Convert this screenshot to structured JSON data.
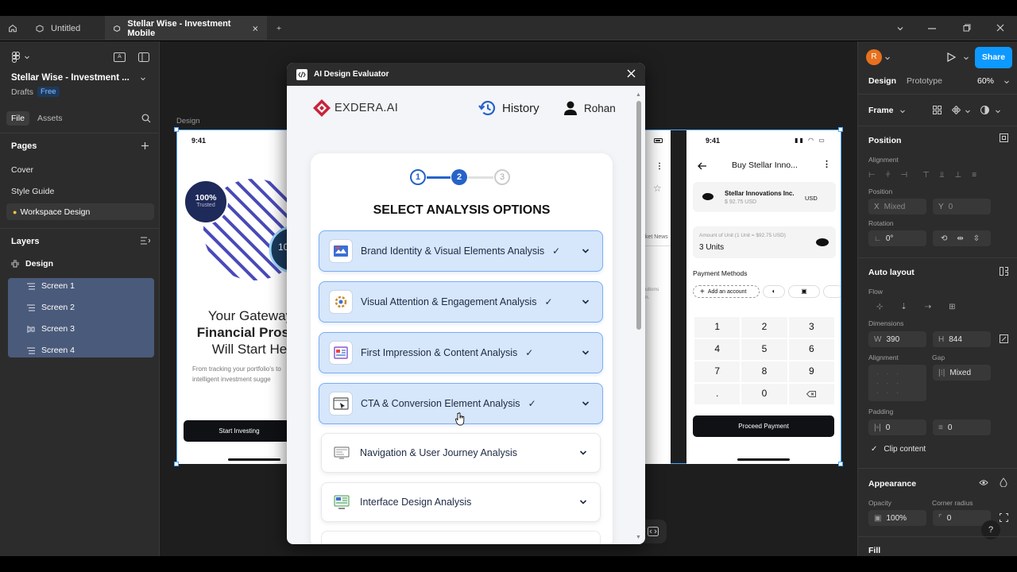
{
  "tabs": {
    "untitled": "Untitled",
    "active": "Stellar Wise - Investment Mobile"
  },
  "file": {
    "name": "Stellar Wise - Investment ...",
    "drafts": "Drafts",
    "plan": "Free"
  },
  "left": {
    "file_tab": "File",
    "assets_tab": "Assets",
    "pages_title": "Pages",
    "pages": [
      "Cover",
      "Style Guide",
      "Workspace Design"
    ],
    "layers_title": "Layers",
    "frame": "Design",
    "layers": [
      "Screen 1",
      "Screen 2",
      "Screen 3",
      "Screen 4"
    ]
  },
  "canvas": {
    "label": "Design",
    "s1": {
      "time": "9:41",
      "badge_pct": "100%",
      "badge_txt": "Trusted",
      "badge2": "10",
      "h1": "Your Gateway",
      "h2": "Financial Prosp",
      "h3": "Will Start He",
      "p1": "From tracking your portfolio's to",
      "p2": "intelligent investment sugge",
      "cta": "Start Investing"
    },
    "s3": {
      "news": "ket News",
      "t1": "utions",
      "t2": "n."
    },
    "s4": {
      "time": "9:41",
      "title": "Buy Stellar Inno...",
      "company": "Stellar Innovations Inc.",
      "price": "$ 92.75 USD",
      "currency": "USD",
      "amount_label": "Amount of Unit (1 Unit = $92.75 USD)",
      "amount": "3 Units",
      "payment_methods": "Payment Methods",
      "add_account": "Add an account",
      "keys": [
        "1",
        "2",
        "3",
        "4",
        "5",
        "6",
        "7",
        "8",
        "9",
        ".",
        "0"
      ],
      "proceed": "Proceed Payment"
    }
  },
  "right": {
    "avatar": "R",
    "share": "Share",
    "design_tab": "Design",
    "prototype_tab": "Prototype",
    "zoom": "60%",
    "frame": "Frame",
    "position": "Position",
    "alignment": "Alignment",
    "position_label": "Position",
    "x_label": "X",
    "x_val": "Mixed",
    "y_label": "Y",
    "y_val": "0",
    "rotation": "Rotation",
    "rotation_val": "0°",
    "auto_layout": "Auto layout",
    "flow": "Flow",
    "dimensions": "Dimensions",
    "w_label": "W",
    "w_val": "390",
    "h_label": "H",
    "h_val": "844",
    "alignment2": "Alignment",
    "gap": "Gap",
    "gap_val": "Mixed",
    "padding": "Padding",
    "pad1": "0",
    "pad2": "0",
    "clip": "Clip content",
    "appearance": "Appearance",
    "opacity": "Opacity",
    "corner": "Corner radius",
    "opacity_val": "100%",
    "corner_val": "0",
    "fill": "Fill",
    "help": "?"
  },
  "modal": {
    "title": "AI Design Evaluator",
    "brand": "EXDERA.AI",
    "history": "History",
    "user": "Rohan",
    "steps": [
      "1",
      "2",
      "3"
    ],
    "heading": "SELECT ANALYSIS OPTIONS",
    "options": [
      {
        "label": "Brand Identity & Visual Elements Analysis",
        "selected": true
      },
      {
        "label": "Visual Attention & Engagement Analysis",
        "selected": true
      },
      {
        "label": "First Impression & Content Analysis",
        "selected": true
      },
      {
        "label": "CTA & Conversion Element Analysis",
        "selected": true
      },
      {
        "label": "Navigation & User Journey Analysis",
        "selected": false
      },
      {
        "label": "Interface Design Analysis",
        "selected": false
      }
    ],
    "accent": "#2563c9"
  }
}
